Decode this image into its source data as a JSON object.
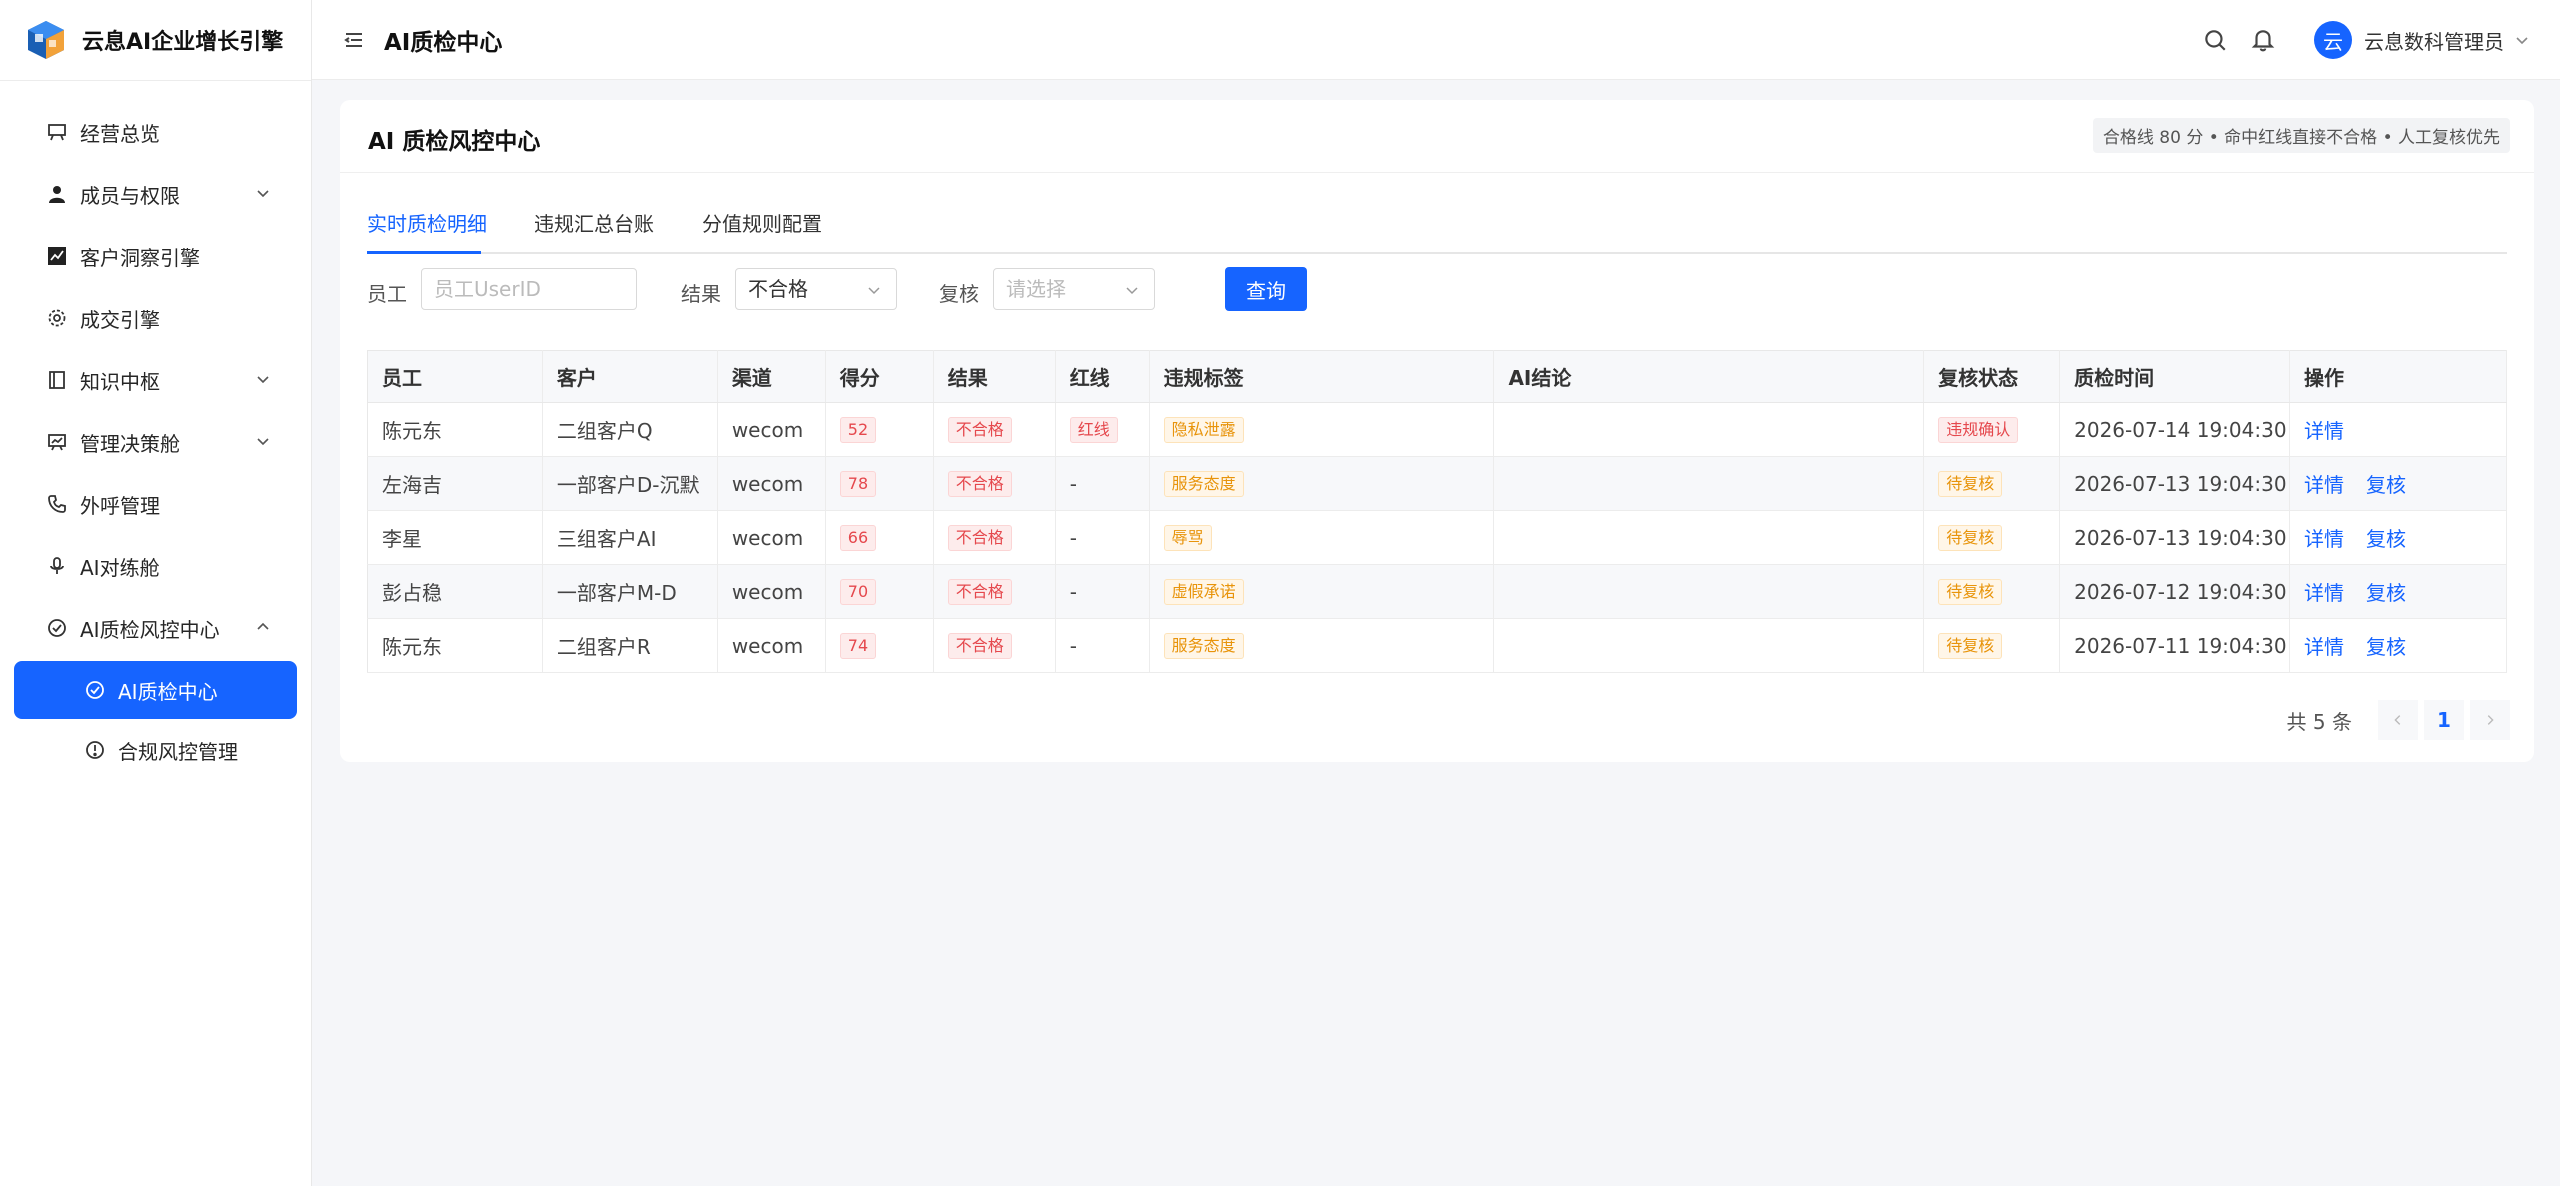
{
  "brand": {
    "name": "云息AI企业增长引擎"
  },
  "sidebar": {
    "items": [
      {
        "label": "经营总览",
        "icon": "presentation-board-icon",
        "chevron": ""
      },
      {
        "label": "成员与权限",
        "icon": "user-icon",
        "chevron": "down"
      },
      {
        "label": "客户洞察引擎",
        "icon": "trend-chart-icon",
        "chevron": ""
      },
      {
        "label": "成交引擎",
        "icon": "gear-icon",
        "chevron": ""
      },
      {
        "label": "知识中枢",
        "icon": "book-icon",
        "chevron": "down"
      },
      {
        "label": "管理决策舱",
        "icon": "dashboard-board-icon",
        "chevron": "down"
      },
      {
        "label": "外呼管理",
        "icon": "phone-icon",
        "chevron": ""
      },
      {
        "label": "AI对练舱",
        "icon": "microphone-icon",
        "chevron": ""
      },
      {
        "label": "AI质检风控中心",
        "icon": "check-circle-icon",
        "chevron": "up"
      }
    ],
    "sub_items": [
      {
        "label": "AI质检中心",
        "icon": "check-circle-icon",
        "active": true
      },
      {
        "label": "合规风控管理",
        "icon": "alert-circle-icon",
        "active": false
      }
    ]
  },
  "header": {
    "title": "AI质检中心",
    "avatar_text": "云",
    "user_name": "云息数科管理员"
  },
  "card": {
    "title": "AI 质检风控中心",
    "note": "合格线 80 分 • 命中红线直接不合格 • 人工复核优先"
  },
  "tabs": [
    {
      "label": "实时质检明细",
      "active": true
    },
    {
      "label": "违规汇总台账",
      "active": false
    },
    {
      "label": "分值规则配置",
      "active": false
    }
  ],
  "filters": {
    "employee_label": "员工",
    "employee_placeholder": "员工UserID",
    "result_label": "结果",
    "result_value": "不合格",
    "review_label": "复核",
    "review_placeholder": "请选择",
    "query_label": "查询"
  },
  "table": {
    "headers": [
      "员工",
      "客户",
      "渠道",
      "得分",
      "结果",
      "红线",
      "违规标签",
      "AI结论",
      "复核状态",
      "质检时间",
      "操作"
    ],
    "rows": [
      {
        "employee": "陈元东",
        "customer": "二组客户Q",
        "channel": "wecom",
        "score": "52",
        "result": "不合格",
        "redline": "红线",
        "tag": "隐私泄露",
        "ai": "",
        "review": "违规确认",
        "review_color": "red",
        "time": "2026-07-14 19:04:30",
        "actions": [
          "详情"
        ]
      },
      {
        "employee": "左海吉",
        "customer": "一部客户D-沉默",
        "channel": "wecom",
        "score": "78",
        "result": "不合格",
        "redline": "-",
        "tag": "服务态度",
        "ai": "",
        "review": "待复核",
        "review_color": "orange",
        "time": "2026-07-13 19:04:30",
        "actions": [
          "详情",
          "复核"
        ]
      },
      {
        "employee": "李星",
        "customer": "三组客户AI",
        "channel": "wecom",
        "score": "66",
        "result": "不合格",
        "redline": "-",
        "tag": "辱骂",
        "ai": "",
        "review": "待复核",
        "review_color": "orange",
        "time": "2026-07-13 19:04:30",
        "actions": [
          "详情",
          "复核"
        ]
      },
      {
        "employee": "彭占稳",
        "customer": "一部客户M-D",
        "channel": "wecom",
        "score": "70",
        "result": "不合格",
        "redline": "-",
        "tag": "虚假承诺",
        "ai": "",
        "review": "待复核",
        "review_color": "orange",
        "time": "2026-07-12 19:04:30",
        "actions": [
          "详情",
          "复核"
        ]
      },
      {
        "employee": "陈元东",
        "customer": "二组客户R",
        "channel": "wecom",
        "score": "74",
        "result": "不合格",
        "redline": "-",
        "tag": "服务态度",
        "ai": "",
        "review": "待复核",
        "review_color": "orange",
        "time": "2026-07-11 19:04:30",
        "actions": [
          "详情",
          "复核"
        ]
      }
    ]
  },
  "pagination": {
    "total": "共 5 条",
    "current": "1"
  },
  "colors": {
    "primary": "#1664ff",
    "danger": "#e5484d",
    "warning": "#e8940b"
  }
}
